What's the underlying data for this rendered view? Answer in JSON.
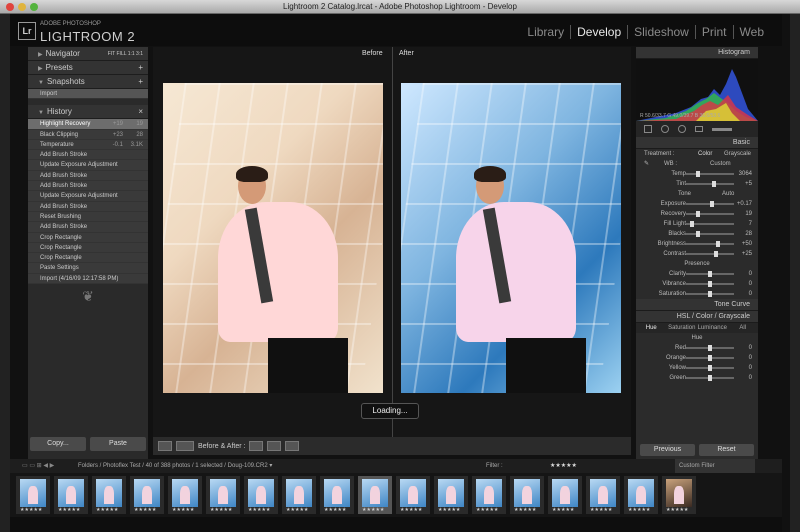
{
  "window_title": "Lightroom 2 Catalog.lrcat - Adobe Photoshop Lightroom - Develop",
  "app": {
    "logo_badge": "Lr",
    "logo_small": "ADOBE PHOTOSHOP",
    "logo_name": "LIGHTROOM 2"
  },
  "modules": [
    "Library",
    "Develop",
    "Slideshow",
    "Print",
    "Web"
  ],
  "left_panel": {
    "navigator": "Navigator",
    "navigator_zoom": "FIT  FILL  1:1  3:1",
    "presets": "Presets",
    "snapshots": "Snapshots",
    "snapshot_item": "Import",
    "history": "History",
    "history_items": [
      {
        "label": "Highlight Recovery",
        "a": "+19",
        "b": "19"
      },
      {
        "label": "Black Clipping",
        "a": "+23",
        "b": "28"
      },
      {
        "label": "Temperature",
        "a": "-0.1",
        "b": "3.1K"
      },
      {
        "label": "Add Brush Stroke",
        "a": "",
        "b": ""
      },
      {
        "label": "Update Exposure Adjustment",
        "a": "",
        "b": ""
      },
      {
        "label": "Add Brush Stroke",
        "a": "",
        "b": ""
      },
      {
        "label": "Add Brush Stroke",
        "a": "",
        "b": ""
      },
      {
        "label": "Update Exposure Adjustment",
        "a": "",
        "b": ""
      },
      {
        "label": "Add Brush Stroke",
        "a": "",
        "b": ""
      },
      {
        "label": "Reset Brushing",
        "a": "",
        "b": ""
      },
      {
        "label": "Add Brush Stroke",
        "a": "",
        "b": ""
      },
      {
        "label": "Crop Rectangle",
        "a": "",
        "b": ""
      },
      {
        "label": "Crop Rectangle",
        "a": "",
        "b": ""
      },
      {
        "label": "Crop Rectangle",
        "a": "",
        "b": ""
      },
      {
        "label": "Paste Settings",
        "a": "",
        "b": ""
      },
      {
        "label": "Import (4/16/09 12:17:58 PM)",
        "a": "",
        "b": ""
      }
    ],
    "copy_btn": "Copy...",
    "paste_btn": "Paste"
  },
  "center": {
    "before_label": "Before",
    "after_label": "After",
    "loading": "Loading...",
    "view_mode": "Before & After :"
  },
  "right_panel": {
    "histogram": "Histogram",
    "hist_stats": "R 50.6/33.7  G 49.0/39.7  B 36.6/53.6",
    "basic": "Basic",
    "treatment_label": "Treatment :",
    "treatment_options": [
      "Color",
      "Grayscale"
    ],
    "wb_label": "WB :",
    "wb_value": "Custom",
    "tone_label": "Tone",
    "tone_auto": "Auto",
    "presence_label": "Presence",
    "sliders": [
      {
        "label": "Temp",
        "value": "3064"
      },
      {
        "label": "Tint",
        "value": "+5"
      },
      {
        "label": "Exposure",
        "value": "+0.17"
      },
      {
        "label": "Recovery",
        "value": "19"
      },
      {
        "label": "Fill Light",
        "value": "7"
      },
      {
        "label": "Blacks",
        "value": "28"
      },
      {
        "label": "Brightness",
        "value": "+50"
      },
      {
        "label": "Contrast",
        "value": "+25"
      },
      {
        "label": "Clarity",
        "value": "0"
      },
      {
        "label": "Vibrance",
        "value": "0"
      },
      {
        "label": "Saturation",
        "value": "0"
      }
    ],
    "tone_curve": "Tone Curve",
    "hsl_header": "HSL / Color / Grayscale",
    "hsl_tabs": [
      "Hue",
      "Saturation",
      "Luminance",
      "All"
    ],
    "hue_label": "Hue",
    "hue_rows": [
      {
        "label": "Red",
        "value": "0"
      },
      {
        "label": "Orange",
        "value": "0"
      },
      {
        "label": "Yellow",
        "value": "0"
      },
      {
        "label": "Green",
        "value": "0"
      }
    ],
    "previous_btn": "Previous",
    "reset_btn": "Reset"
  },
  "filterbar": {
    "path": "Folders / Photoflex Test / 40 of 388 photos / 1 selected / Doug-109.CR2 ▾",
    "filter_label": "Filter :",
    "filter_value": "Custom Filter"
  },
  "filmstrip_count": 18,
  "filmstrip_stars": "★★★★★"
}
